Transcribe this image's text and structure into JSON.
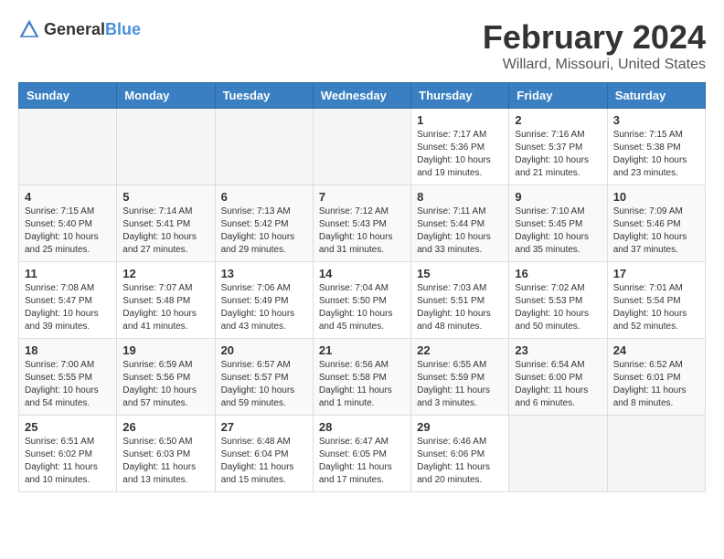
{
  "header": {
    "logo_general": "General",
    "logo_blue": "Blue",
    "title": "February 2024",
    "subtitle": "Willard, Missouri, United States"
  },
  "columns": [
    "Sunday",
    "Monday",
    "Tuesday",
    "Wednesday",
    "Thursday",
    "Friday",
    "Saturday"
  ],
  "weeks": [
    [
      {
        "day": "",
        "info": ""
      },
      {
        "day": "",
        "info": ""
      },
      {
        "day": "",
        "info": ""
      },
      {
        "day": "",
        "info": ""
      },
      {
        "day": "1",
        "info": "Sunrise: 7:17 AM\nSunset: 5:36 PM\nDaylight: 10 hours\nand 19 minutes."
      },
      {
        "day": "2",
        "info": "Sunrise: 7:16 AM\nSunset: 5:37 PM\nDaylight: 10 hours\nand 21 minutes."
      },
      {
        "day": "3",
        "info": "Sunrise: 7:15 AM\nSunset: 5:38 PM\nDaylight: 10 hours\nand 23 minutes."
      }
    ],
    [
      {
        "day": "4",
        "info": "Sunrise: 7:15 AM\nSunset: 5:40 PM\nDaylight: 10 hours\nand 25 minutes."
      },
      {
        "day": "5",
        "info": "Sunrise: 7:14 AM\nSunset: 5:41 PM\nDaylight: 10 hours\nand 27 minutes."
      },
      {
        "day": "6",
        "info": "Sunrise: 7:13 AM\nSunset: 5:42 PM\nDaylight: 10 hours\nand 29 minutes."
      },
      {
        "day": "7",
        "info": "Sunrise: 7:12 AM\nSunset: 5:43 PM\nDaylight: 10 hours\nand 31 minutes."
      },
      {
        "day": "8",
        "info": "Sunrise: 7:11 AM\nSunset: 5:44 PM\nDaylight: 10 hours\nand 33 minutes."
      },
      {
        "day": "9",
        "info": "Sunrise: 7:10 AM\nSunset: 5:45 PM\nDaylight: 10 hours\nand 35 minutes."
      },
      {
        "day": "10",
        "info": "Sunrise: 7:09 AM\nSunset: 5:46 PM\nDaylight: 10 hours\nand 37 minutes."
      }
    ],
    [
      {
        "day": "11",
        "info": "Sunrise: 7:08 AM\nSunset: 5:47 PM\nDaylight: 10 hours\nand 39 minutes."
      },
      {
        "day": "12",
        "info": "Sunrise: 7:07 AM\nSunset: 5:48 PM\nDaylight: 10 hours\nand 41 minutes."
      },
      {
        "day": "13",
        "info": "Sunrise: 7:06 AM\nSunset: 5:49 PM\nDaylight: 10 hours\nand 43 minutes."
      },
      {
        "day": "14",
        "info": "Sunrise: 7:04 AM\nSunset: 5:50 PM\nDaylight: 10 hours\nand 45 minutes."
      },
      {
        "day": "15",
        "info": "Sunrise: 7:03 AM\nSunset: 5:51 PM\nDaylight: 10 hours\nand 48 minutes."
      },
      {
        "day": "16",
        "info": "Sunrise: 7:02 AM\nSunset: 5:53 PM\nDaylight: 10 hours\nand 50 minutes."
      },
      {
        "day": "17",
        "info": "Sunrise: 7:01 AM\nSunset: 5:54 PM\nDaylight: 10 hours\nand 52 minutes."
      }
    ],
    [
      {
        "day": "18",
        "info": "Sunrise: 7:00 AM\nSunset: 5:55 PM\nDaylight: 10 hours\nand 54 minutes."
      },
      {
        "day": "19",
        "info": "Sunrise: 6:59 AM\nSunset: 5:56 PM\nDaylight: 10 hours\nand 57 minutes."
      },
      {
        "day": "20",
        "info": "Sunrise: 6:57 AM\nSunset: 5:57 PM\nDaylight: 10 hours\nand 59 minutes."
      },
      {
        "day": "21",
        "info": "Sunrise: 6:56 AM\nSunset: 5:58 PM\nDaylight: 11 hours\nand 1 minute."
      },
      {
        "day": "22",
        "info": "Sunrise: 6:55 AM\nSunset: 5:59 PM\nDaylight: 11 hours\nand 3 minutes."
      },
      {
        "day": "23",
        "info": "Sunrise: 6:54 AM\nSunset: 6:00 PM\nDaylight: 11 hours\nand 6 minutes."
      },
      {
        "day": "24",
        "info": "Sunrise: 6:52 AM\nSunset: 6:01 PM\nDaylight: 11 hours\nand 8 minutes."
      }
    ],
    [
      {
        "day": "25",
        "info": "Sunrise: 6:51 AM\nSunset: 6:02 PM\nDaylight: 11 hours\nand 10 minutes."
      },
      {
        "day": "26",
        "info": "Sunrise: 6:50 AM\nSunset: 6:03 PM\nDaylight: 11 hours\nand 13 minutes."
      },
      {
        "day": "27",
        "info": "Sunrise: 6:48 AM\nSunset: 6:04 PM\nDaylight: 11 hours\nand 15 minutes."
      },
      {
        "day": "28",
        "info": "Sunrise: 6:47 AM\nSunset: 6:05 PM\nDaylight: 11 hours\nand 17 minutes."
      },
      {
        "day": "29",
        "info": "Sunrise: 6:46 AM\nSunset: 6:06 PM\nDaylight: 11 hours\nand 20 minutes."
      },
      {
        "day": "",
        "info": ""
      },
      {
        "day": "",
        "info": ""
      }
    ]
  ]
}
